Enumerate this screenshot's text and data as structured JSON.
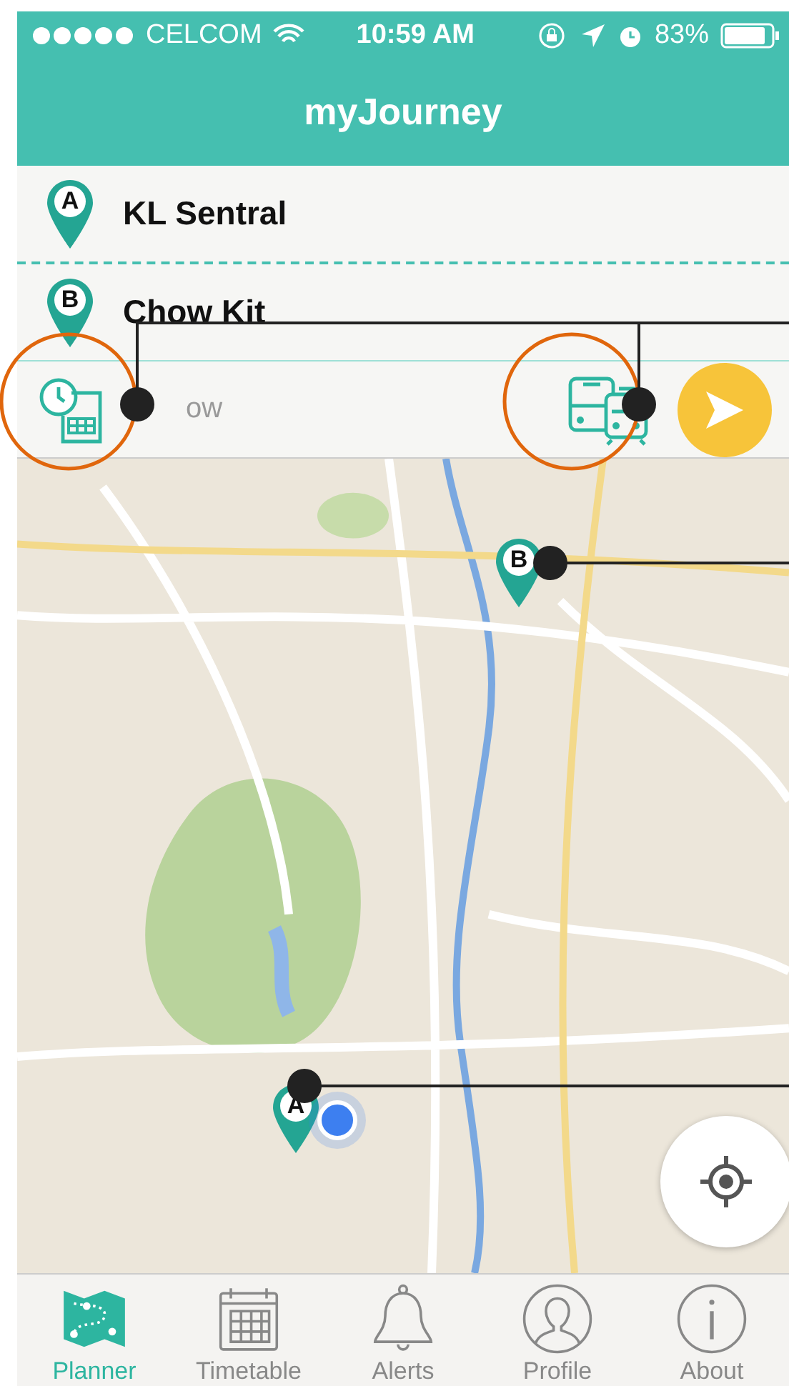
{
  "status_bar": {
    "carrier": "CELCOM",
    "time": "10:59 AM",
    "battery": "83%"
  },
  "header": {
    "title": "myJourney"
  },
  "route": {
    "stops": [
      {
        "marker": "A",
        "name": "KL Sentral"
      },
      {
        "marker": "B",
        "name": "Chow Kit"
      }
    ],
    "time_field": {
      "value": "ow"
    }
  },
  "map": {
    "kind": "picture",
    "markers": [
      {
        "label": "B"
      },
      {
        "label": "A"
      }
    ]
  },
  "tabs": [
    {
      "label": "Planner",
      "selected": true,
      "kind": "map"
    },
    {
      "label": "Timetable",
      "selected": false,
      "kind": "calendar"
    },
    {
      "label": "Alerts",
      "selected": false,
      "kind": "bell"
    },
    {
      "label": "Profile",
      "selected": false,
      "kind": "person"
    },
    {
      "label": "About",
      "selected": false,
      "kind": "info"
    }
  ]
}
